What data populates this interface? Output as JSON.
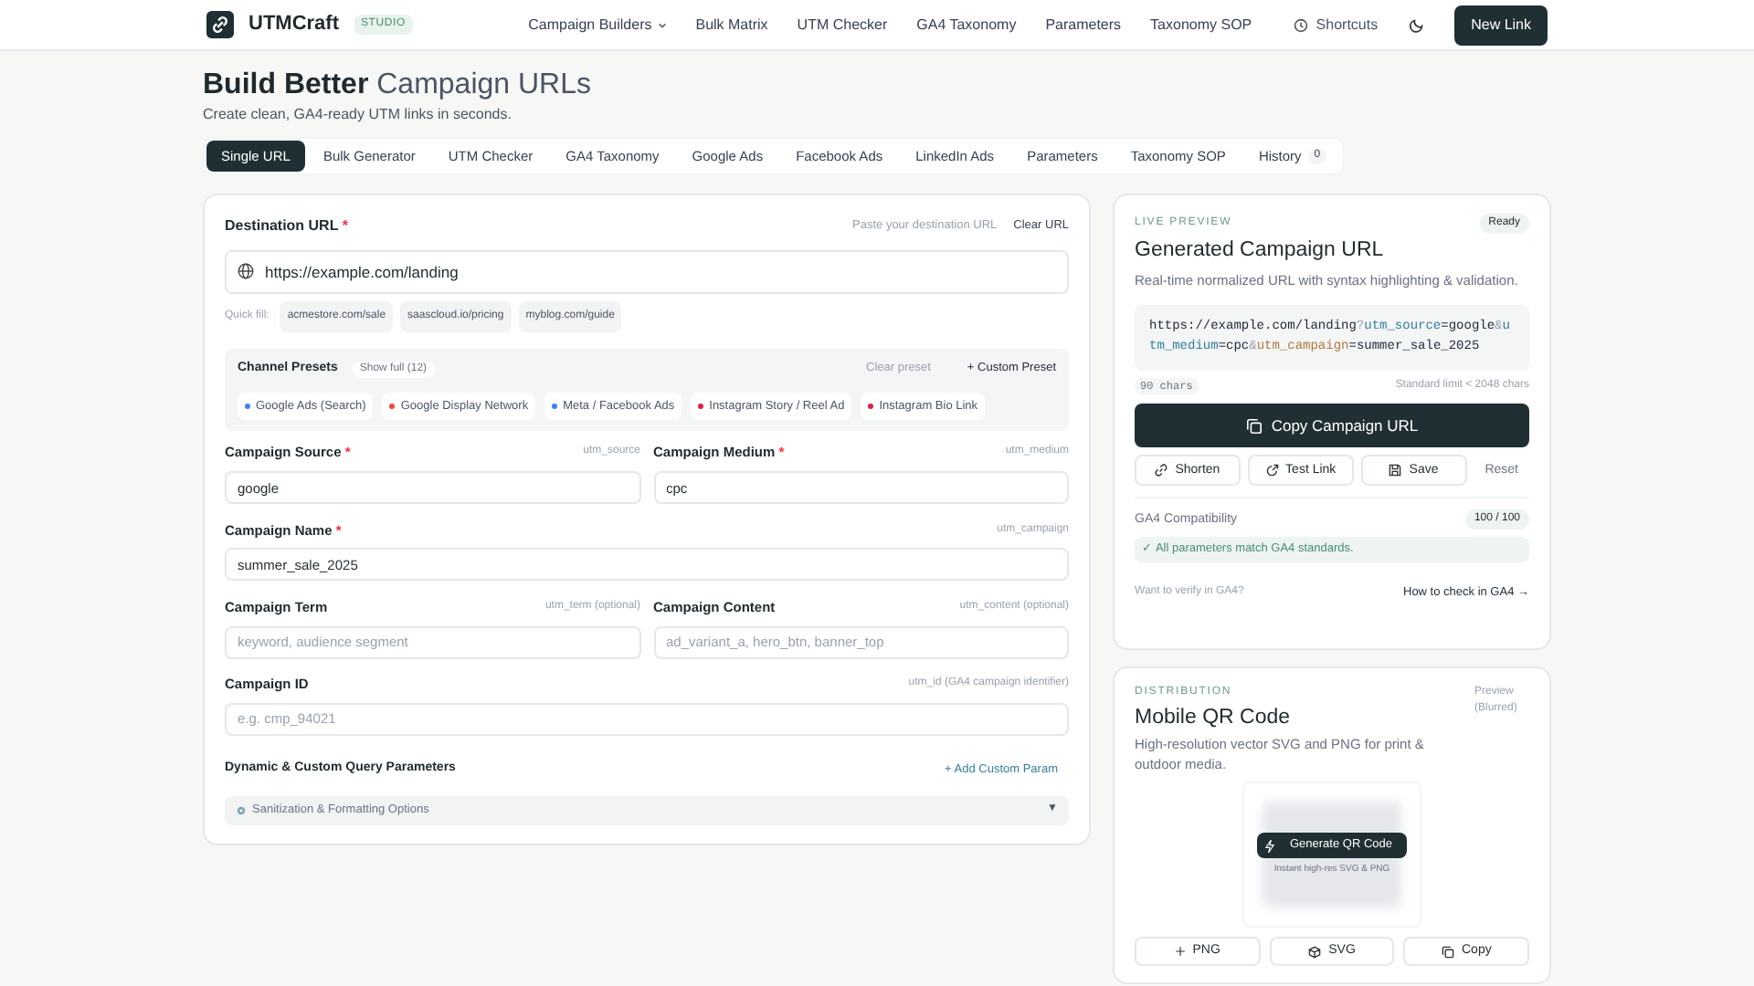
{
  "brand": {
    "name": "UTMCraft",
    "badge": "STUDIO"
  },
  "nav": [
    {
      "label": "Campaign Builders",
      "dropdown": true
    },
    {
      "label": "Bulk Matrix",
      "dropdown": false
    },
    {
      "label": "UTM Checker",
      "dropdown": false
    },
    {
      "label": "GA4 Taxonomy",
      "dropdown": false
    },
    {
      "label": "Parameters",
      "dropdown": false
    },
    {
      "label": "Taxonomy SOP",
      "dropdown": false
    }
  ],
  "header_actions": {
    "shortcuts": "Shortcuts",
    "new_link": "New Link"
  },
  "hero": {
    "title_strong": "Build Better",
    "title_light": "Campaign URLs",
    "subtitle": "Create clean, GA4-ready UTM links in seconds."
  },
  "tabs": [
    {
      "label": "Single URL",
      "selected": true
    },
    {
      "label": "Bulk Generator",
      "selected": false
    },
    {
      "label": "UTM Checker",
      "selected": false
    },
    {
      "label": "GA4 Taxonomy",
      "selected": false
    },
    {
      "label": "Google Ads",
      "selected": false
    },
    {
      "label": "Facebook Ads",
      "selected": false
    },
    {
      "label": "LinkedIn Ads",
      "selected": false
    },
    {
      "label": "Parameters",
      "selected": false
    },
    {
      "label": "Taxonomy SOP",
      "selected": false
    },
    {
      "label": "History",
      "selected": false,
      "count": "0"
    }
  ],
  "destination": {
    "label": "Destination URL",
    "required": true,
    "hint": "Paste your destination URL",
    "clear": "Clear URL",
    "value": "https://example.com/landing"
  },
  "quick_fill": {
    "label": "Quick fill:",
    "items": [
      "acmestore.com/sale",
      "saascloud.io/pricing",
      "myblog.com/guide"
    ]
  },
  "presets": {
    "title": "Channel Presets",
    "show_full": "Show full (12)",
    "clear": "Clear preset",
    "custom": "+ Custom Preset",
    "items": [
      {
        "label": "Google Ads (Search)",
        "color": "#3b82f6"
      },
      {
        "label": "Google Display Network",
        "color": "#ef4444"
      },
      {
        "label": "Meta / Facebook Ads",
        "color": "#3b82f6"
      },
      {
        "label": "Instagram Story / Reel Ad",
        "color": "#e11d48"
      },
      {
        "label": "Instagram Bio Link",
        "color": "#e11d48"
      }
    ]
  },
  "required_mark": "*",
  "field_rows": [
    [
      {
        "label": "Campaign Source",
        "required": true,
        "param": "utm_source",
        "value": "google"
      },
      {
        "label": "Campaign Medium",
        "required": true,
        "param": "utm_medium",
        "value": "cpc"
      }
    ],
    [
      {
        "label": "Campaign Name",
        "required": true,
        "param": "utm_campaign",
        "value": "summer_sale_2025"
      }
    ],
    [
      {
        "label": "Campaign Term",
        "required": false,
        "param": "utm_term (optional)",
        "placeholder": "keyword, audience segment"
      },
      {
        "label": "Campaign Content",
        "required": false,
        "param": "utm_content (optional)",
        "placeholder": "ad_variant_a, hero_btn, banner_top"
      }
    ],
    [
      {
        "label": "Campaign ID",
        "required": false,
        "param": "utm_id (GA4 campaign identifier)",
        "placeholder": "e.g. cmp_94021"
      }
    ]
  ],
  "custom_params": {
    "title": "Dynamic & Custom Query Parameters",
    "add": "+ Add Custom Param"
  },
  "sanitization": {
    "label": "Sanitization & Formatting Options",
    "expanded": false,
    "caret": "▼"
  },
  "preview": {
    "eyebrow": "LIVE PREVIEW",
    "status": "Ready",
    "title": "Generated Campaign URL",
    "description": "Real-time normalized URL with syntax highlighting & validation.",
    "url": [
      {
        "kind": "text",
        "text": "https://example.com/landing"
      },
      {
        "kind": "sep",
        "text": "?"
      },
      {
        "kind": "key",
        "text": "utm_source",
        "color": "#2f7fa0"
      },
      {
        "kind": "text",
        "text": "=google"
      },
      {
        "kind": "sep",
        "text": "&"
      },
      {
        "kind": "key",
        "text": "utm_medium",
        "color": "#2f7fa0"
      },
      {
        "kind": "text",
        "text": "=cpc"
      },
      {
        "kind": "sep",
        "text": "&"
      },
      {
        "kind": "key",
        "text": "utm_campaign",
        "color": "#b07a3a"
      },
      {
        "kind": "text",
        "text": "=summer_sale_2025"
      }
    ],
    "chars": "90 chars",
    "limit": "Standard limit < 2048 chars",
    "copy": "Copy Campaign URL",
    "actions": [
      {
        "kind": "link",
        "label": "Shorten"
      },
      {
        "kind": "test",
        "label": "Test Link"
      },
      {
        "kind": "save",
        "label": "Save"
      },
      {
        "kind": "plain",
        "label": "Reset"
      }
    ],
    "ga4": {
      "label": "GA4 Compatibility",
      "score": "100 / 100",
      "message": "✓ All parameters match GA4 standards."
    },
    "verify": {
      "question": "Want to verify in GA4?",
      "link": "How to check in GA4 →"
    }
  },
  "qr": {
    "eyebrow": "DISTRIBUTION",
    "preview_note": "Preview (Blurred)",
    "title": "Mobile QR Code",
    "description": "High-resolution vector SVG and PNG for print & outdoor media.",
    "generate": "Generate QR Code",
    "note": "Instant high-res SVG & PNG",
    "downloads": [
      {
        "kind": "png",
        "label": "PNG"
      },
      {
        "kind": "svg",
        "label": "SVG"
      },
      {
        "kind": "copy",
        "label": "Copy"
      }
    ]
  }
}
